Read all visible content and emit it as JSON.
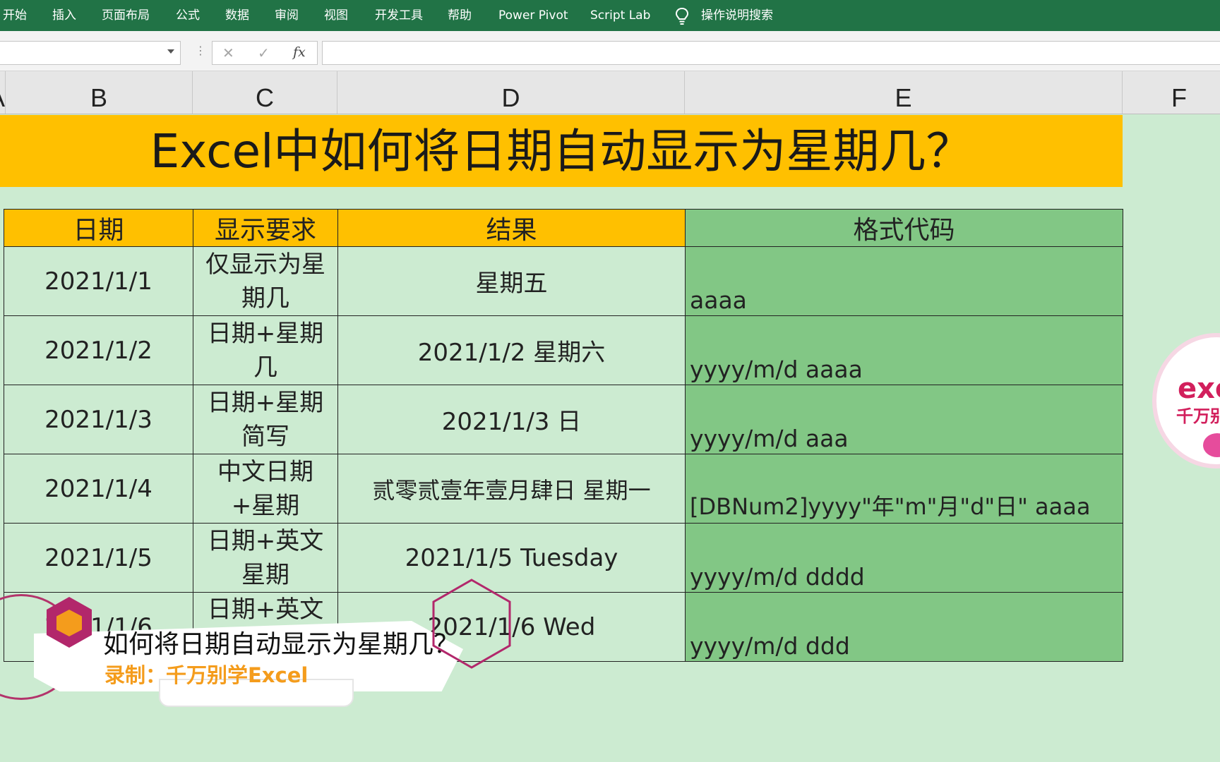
{
  "ribbon": {
    "tabs": [
      "开始",
      "插入",
      "页面布局",
      "公式",
      "数据",
      "审阅",
      "视图",
      "开发工具",
      "帮助",
      "Power Pivot",
      "Script Lab"
    ],
    "search_label": "操作说明搜索"
  },
  "formula_bar": {
    "name_box": "",
    "cancel": "✕",
    "enter": "✓",
    "fx": "fx",
    "formula": ""
  },
  "columns": [
    "A",
    "B",
    "C",
    "D",
    "E",
    "F"
  ],
  "banner": {
    "title": "Excel中如何将日期自动显示为星期几？"
  },
  "table": {
    "headers": [
      "日期",
      "显示要求",
      "结果",
      "格式代码"
    ],
    "rows": [
      {
        "date": "2021/1/1",
        "req": "仅显示为星期几",
        "result": "星期五",
        "code": "aaaa"
      },
      {
        "date": "2021/1/2",
        "req": "日期+星期几",
        "result": "2021/1/2 星期六",
        "code": "yyyy/m/d aaaa"
      },
      {
        "date": "2021/1/3",
        "req": "日期+星期简写",
        "result": "2021/1/3 日",
        "code": "yyyy/m/d aaa"
      },
      {
        "date": "2021/1/4",
        "req": "中文日期+星期",
        "result": "贰零贰壹年壹月肆日 星期一",
        "code": "[DBNum2]yyyy\"年\"m\"月\"d\"日\" aaaa"
      },
      {
        "date": "2021/1/5",
        "req": "日期+英文星期",
        "result": "2021/1/5 Tuesday",
        "code": "yyyy/m/d dddd"
      },
      {
        "date": "2021/1/6",
        "req": "日期+英文",
        "result": "2021/1/6 Wed",
        "code": "yyyy/m/d ddd"
      }
    ]
  },
  "logo": {
    "text": "exc",
    "subtext": "千万别"
  },
  "overlay": {
    "title": "如何将日期自动显示为星期几？",
    "subtitle": "录制：千万别学Excel"
  },
  "colors": {
    "ribbon": "#217346",
    "banner": "#ffc000",
    "code_column": "#82c785",
    "sheet_background": "#ccebd1",
    "overlay_accent": "#b2276b",
    "overlay_orange": "#f49c1c"
  }
}
